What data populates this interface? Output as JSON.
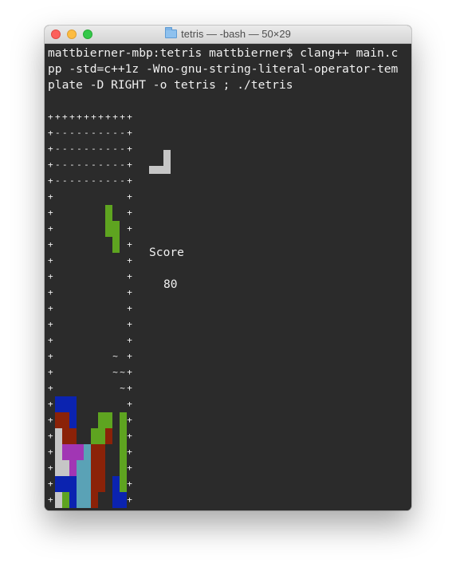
{
  "window": {
    "title": "tetris — -bash — 50×29"
  },
  "terminal": {
    "command_lines": [
      "mattbierner-mbp:tetris mattbierner$ clang++ main.c",
      "pp -std=c++1z -Wno-gnu-string-literal-operator-tem",
      "plate -D RIGHT -o tetris ; ./tetris"
    ],
    "board_lines": [
      "++++++++++++",
      "+----------+",
      "+----------+",
      "+----------+",
      "+----------+",
      "+          +",
      "+          +",
      "+          +",
      "+          +",
      "+          +",
      "+          +",
      "+          +",
      "+          +",
      "+          +",
      "+          +",
      "+        ~ +",
      "+        ~~+",
      "+         ~+",
      "+          +",
      "+          +",
      "+          +",
      "+          +",
      "+          +",
      "+          +",
      "+          +",
      "++++++++++++"
    ],
    "score_label": "Score",
    "score_value": "80"
  },
  "colors": {
    "background": "#2b2b2b",
    "text": "#f0f0f0",
    "grey": "#c6c6c6",
    "green": "#5ea420",
    "blue": "#0b23b0",
    "red": "#8b2208",
    "purple": "#a136b4",
    "cyan": "#5aa2b6"
  },
  "board_cells": [
    {
      "row": 5,
      "col": 8,
      "color": "green"
    },
    {
      "row": 6,
      "col": 8,
      "color": "green"
    },
    {
      "row": 6,
      "col": 9,
      "color": "green"
    },
    {
      "row": 7,
      "col": 9,
      "color": "green"
    },
    {
      "row": 17,
      "col": 1,
      "color": "blue"
    },
    {
      "row": 17,
      "col": 2,
      "color": "blue"
    },
    {
      "row": 17,
      "col": 3,
      "color": "blue"
    },
    {
      "row": 18,
      "col": 1,
      "color": "red"
    },
    {
      "row": 18,
      "col": 2,
      "color": "red"
    },
    {
      "row": 18,
      "col": 3,
      "color": "blue"
    },
    {
      "row": 18,
      "col": 7,
      "color": "green"
    },
    {
      "row": 18,
      "col": 8,
      "color": "green"
    },
    {
      "row": 18,
      "col": 10,
      "color": "green"
    },
    {
      "row": 19,
      "col": 1,
      "color": "grey"
    },
    {
      "row": 19,
      "col": 2,
      "color": "red"
    },
    {
      "row": 19,
      "col": 3,
      "color": "red"
    },
    {
      "row": 19,
      "col": 6,
      "color": "green"
    },
    {
      "row": 19,
      "col": 7,
      "color": "green"
    },
    {
      "row": 19,
      "col": 8,
      "color": "red"
    },
    {
      "row": 19,
      "col": 10,
      "color": "green"
    },
    {
      "row": 20,
      "col": 1,
      "color": "grey"
    },
    {
      "row": 20,
      "col": 2,
      "color": "purple"
    },
    {
      "row": 20,
      "col": 3,
      "color": "purple"
    },
    {
      "row": 20,
      "col": 4,
      "color": "purple"
    },
    {
      "row": 20,
      "col": 5,
      "color": "cyan"
    },
    {
      "row": 20,
      "col": 6,
      "color": "red"
    },
    {
      "row": 20,
      "col": 7,
      "color": "red"
    },
    {
      "row": 20,
      "col": 10,
      "color": "green"
    },
    {
      "row": 21,
      "col": 1,
      "color": "grey"
    },
    {
      "row": 21,
      "col": 2,
      "color": "grey"
    },
    {
      "row": 21,
      "col": 3,
      "color": "purple"
    },
    {
      "row": 21,
      "col": 4,
      "color": "cyan"
    },
    {
      "row": 21,
      "col": 5,
      "color": "cyan"
    },
    {
      "row": 21,
      "col": 6,
      "color": "red"
    },
    {
      "row": 21,
      "col": 7,
      "color": "red"
    },
    {
      "row": 21,
      "col": 10,
      "color": "green"
    },
    {
      "row": 22,
      "col": 1,
      "color": "blue"
    },
    {
      "row": 22,
      "col": 2,
      "color": "blue"
    },
    {
      "row": 22,
      "col": 3,
      "color": "blue"
    },
    {
      "row": 22,
      "col": 4,
      "color": "cyan"
    },
    {
      "row": 22,
      "col": 5,
      "color": "cyan"
    },
    {
      "row": 22,
      "col": 6,
      "color": "red"
    },
    {
      "row": 22,
      "col": 7,
      "color": "red"
    },
    {
      "row": 22,
      "col": 9,
      "color": "blue"
    },
    {
      "row": 22,
      "col": 10,
      "color": "green"
    },
    {
      "row": 23,
      "col": 1,
      "color": "grey"
    },
    {
      "row": 23,
      "col": 2,
      "color": "green"
    },
    {
      "row": 23,
      "col": 3,
      "color": "blue"
    },
    {
      "row": 23,
      "col": 4,
      "color": "cyan"
    },
    {
      "row": 23,
      "col": 5,
      "color": "cyan"
    },
    {
      "row": 23,
      "col": 6,
      "color": "red"
    },
    {
      "row": 23,
      "col": 9,
      "color": "blue"
    },
    {
      "row": 23,
      "col": 10,
      "color": "blue"
    }
  ],
  "next_piece_cells": [
    {
      "row": 0,
      "col": 2,
      "color": "grey"
    },
    {
      "row": 1,
      "col": 2,
      "color": "grey"
    },
    {
      "row": 2,
      "col": 0,
      "color": "grey"
    },
    {
      "row": 2,
      "col": 1,
      "color": "grey"
    },
    {
      "row": 2,
      "col": 2,
      "color": "grey"
    }
  ]
}
